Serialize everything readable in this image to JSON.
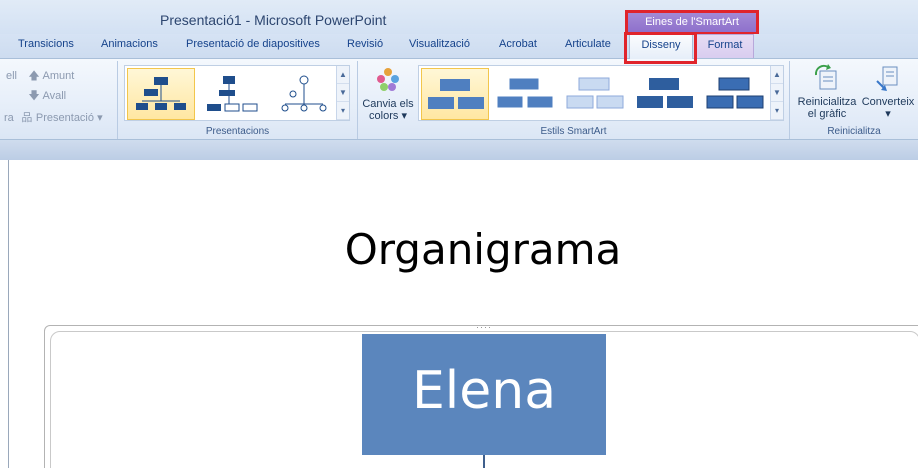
{
  "window": {
    "title": "Presentació1 - Microsoft PowerPoint",
    "contextual_header": "Eines de l'SmartArt"
  },
  "tabs": [
    {
      "label": "Transicions"
    },
    {
      "label": "Animacions"
    },
    {
      "label": "Presentació de diapositives"
    },
    {
      "label": "Revisió"
    },
    {
      "label": "Visualització"
    },
    {
      "label": "Acrobat"
    },
    {
      "label": "Articulate"
    },
    {
      "label": "Disseny"
    },
    {
      "label": "Format"
    }
  ],
  "ribbon": {
    "create_graphic": {
      "up_label": "Amunt",
      "down_label": "Avall",
      "layout_label": "Presentació",
      "clipped_left_top": "ell",
      "clipped_left_bottom": "ra"
    },
    "layouts_group": {
      "label": "Presentacions"
    },
    "styles_group": {
      "label": "Estils SmartArt",
      "change_colors_line1": "Canvia els",
      "change_colors_line2": "colors"
    },
    "reset_group": {
      "label": "Reinicialitza",
      "reset_line1": "Reinicialitza",
      "reset_line2": "el gràfic",
      "convert_label": "Converteix"
    }
  },
  "slide": {
    "title": "Organigrama",
    "top_node": "Elena"
  },
  "colors": {
    "accent_purple": "#8d6fcb",
    "highlight_red": "#e0242b",
    "node_blue": "#5b86bd"
  }
}
